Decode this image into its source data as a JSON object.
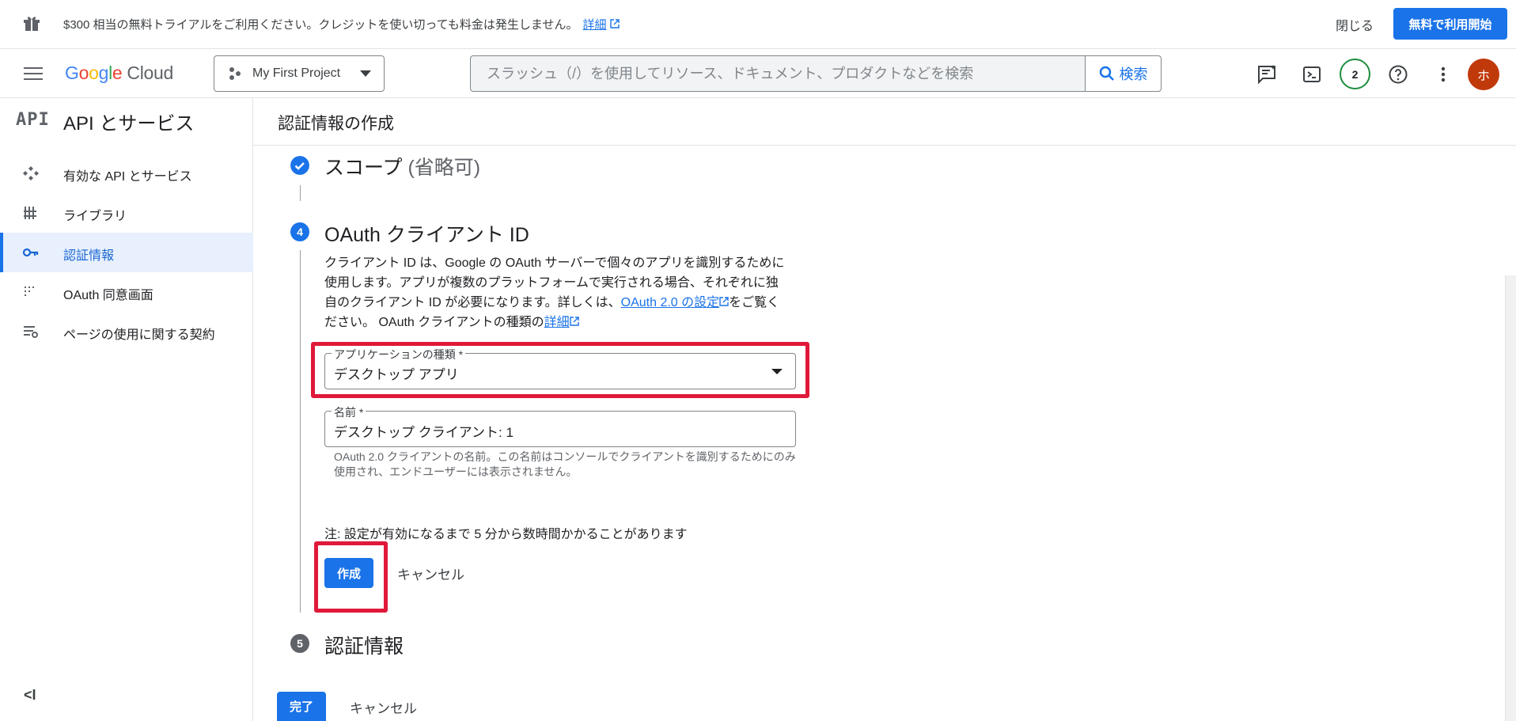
{
  "banner": {
    "message": "$300 相当の無料トライアルをご利用ください。クレジットを使い切っても料金は発生しません。",
    "details_link": "詳細",
    "close_label": "閉じる",
    "trial_button": "無料で利用開始"
  },
  "header": {
    "logo_google": [
      "G",
      "o",
      "o",
      "g",
      "l",
      "e"
    ],
    "logo_cloud": "Cloud",
    "project_name": "My First Project",
    "search_placeholder": "スラッシュ（/）を使用してリソース、ドキュメント、プロダクトなどを検索",
    "search_button": "検索",
    "notification_count": "2",
    "avatar_initial": "ホ"
  },
  "sidebar": {
    "logo": "API",
    "title": "API とサービス",
    "items": [
      {
        "label": "有効な API とサービス",
        "icon": "enabled-apis-icon"
      },
      {
        "label": "ライブラリ",
        "icon": "library-icon"
      },
      {
        "label": "認証情報",
        "icon": "key-icon",
        "active": true
      },
      {
        "label": "OAuth 同意画面",
        "icon": "consent-screen-icon"
      },
      {
        "label": "ページの使用に関する契約",
        "icon": "page-agreements-icon"
      }
    ],
    "collapse_label": "<I"
  },
  "main": {
    "title": "認証情報の作成",
    "step3": {
      "title": "スコープ",
      "optional": "(省略可)"
    },
    "step4": {
      "number": "4",
      "title": "OAuth クライアント ID",
      "description_line1": "クライアント ID は、Google の OAuth サーバーで個々のアプリを識別するために",
      "description_line2": "使用します。アプリが複数のプラットフォームで実行される場合、それぞれに独",
      "description_line3a": "自のクライアント ID が必要になります。詳しくは、",
      "description_link1": "OAuth 2.0 の設定",
      "description_line3b": "をご覧く",
      "description_line4a": "ださい。 OAuth クライアントの種類の",
      "description_link2": "詳細",
      "app_type_label": "アプリケーションの種類 *",
      "app_type_value": "デスクトップ アプリ",
      "name_label": "名前 *",
      "name_value": "デスクトップ クライアント: 1",
      "name_helper": "OAuth 2.0 クライアントの名前。この名前はコンソールでクライアントを識別するためにのみ使用され、エンドユーザーには表示されません。",
      "note": "注: 設定が有効になるまで 5 分から数時間かかることがあります",
      "create_button": "作成",
      "cancel_button": "キャンセル"
    },
    "step5": {
      "number": "5",
      "title": "認証情報"
    },
    "done_button": "完了",
    "bottom_cancel": "キャンセル"
  },
  "colors": {
    "primary": "#1a73e8",
    "highlight": "#e0193a",
    "active_bg": "#e8f0fe",
    "avatar": "#c0390b"
  }
}
